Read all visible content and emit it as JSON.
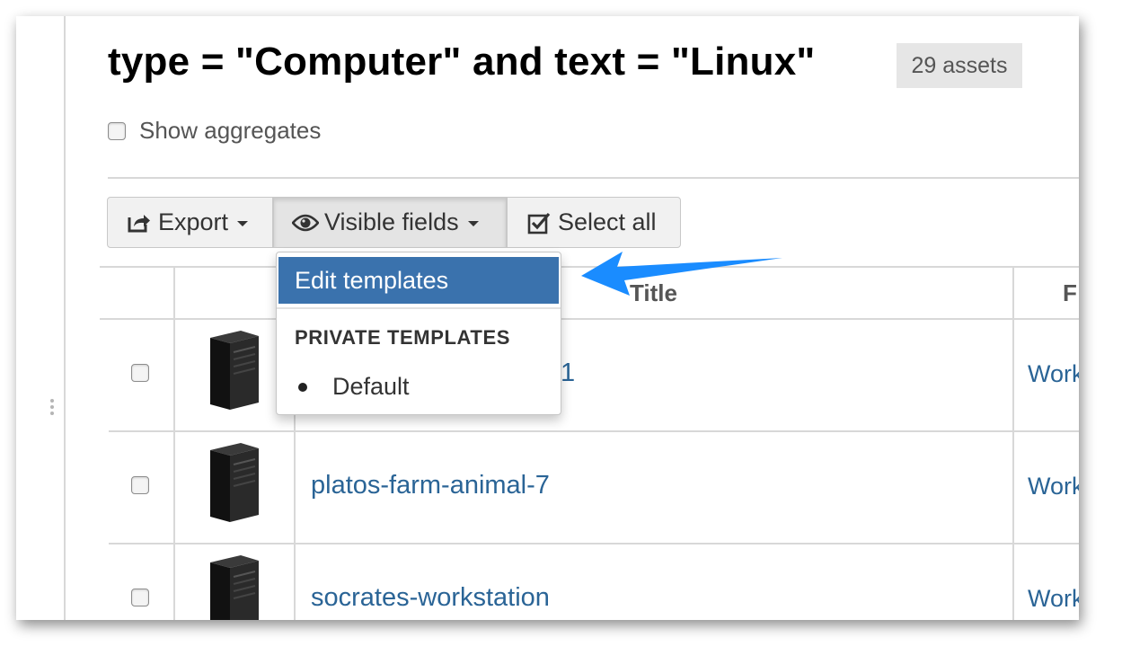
{
  "query": {
    "title": "type = \"Computer\" and text = \"Linux\"",
    "count_badge": "29 assets"
  },
  "options": {
    "show_aggregates_label": "Show aggregates",
    "show_aggregates_checked": false
  },
  "toolbar": {
    "export_label": "Export",
    "visible_fields_label": "Visible fields",
    "select_all_label": "Select all"
  },
  "dropdown": {
    "edit_templates_label": "Edit templates",
    "section_header": "PRIVATE TEMPLATES",
    "items": [
      "Default"
    ]
  },
  "table": {
    "columns": [
      "Title",
      "F"
    ],
    "rows": [
      {
        "title": "1",
        "field": "Work"
      },
      {
        "title": "platos-farm-animal-7",
        "field": "Work"
      },
      {
        "title": "socrates-workstation",
        "field": "Work"
      }
    ]
  },
  "colors": {
    "link": "#2a6496",
    "dropdown_active": "#3a72ad",
    "annotation_arrow": "#1a8cff"
  },
  "icons": {
    "export": "share-icon",
    "visible_fields": "eye-icon",
    "select_all": "checkbox-checked-icon",
    "asset_thumbnail": "computer-tower-icon"
  }
}
